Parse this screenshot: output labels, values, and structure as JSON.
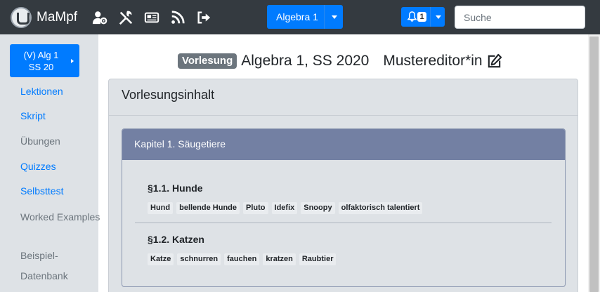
{
  "navbar": {
    "brand": "MaMpf",
    "icons": [
      "user-cog-icon",
      "tools-icon",
      "newspaper-icon",
      "rss-icon",
      "sign-out-icon"
    ],
    "lecture_button": "Algebra 1",
    "notifications": {
      "count": "1",
      "icon": "bell-icon"
    },
    "search": {
      "placeholder": "Suche",
      "value": ""
    },
    "colors": {
      "bar": "#343a40",
      "accent": "#007bff"
    }
  },
  "sidebar": {
    "lecture": {
      "line1": "(V) Alg 1",
      "line2": "SS 20"
    },
    "links": [
      {
        "label": "Lektionen",
        "active": true
      },
      {
        "label": "Skript",
        "active": true
      },
      {
        "label": "Übungen",
        "active": false
      },
      {
        "label": "Quizzes",
        "active": true
      },
      {
        "label": "Selbsttest",
        "active": true
      },
      {
        "label": "Worked Examples",
        "active": false
      }
    ],
    "example_db": {
      "line1": "Beispiel-",
      "line2": "Datenbank"
    }
  },
  "heading": {
    "badge": "Vorlesung",
    "title": "Algebra 1, SS 2020",
    "editor": "Mustereditor*in",
    "edit_icon": "edit-icon"
  },
  "content": {
    "title": "Vorlesungsinhalt",
    "chapter": {
      "title": "Kapitel 1. Säugetiere",
      "sections": [
        {
          "title": "§1.1. Hunde",
          "tags": [
            "Hund",
            "bellende Hunde",
            "Pluto",
            "Idefix",
            "Snoopy",
            "olfaktorisch talentiert"
          ]
        },
        {
          "title": "§1.2. Katzen",
          "tags": [
            "Katze",
            "schnurren",
            "fauchen",
            "kratzen",
            "Raubtier"
          ]
        }
      ]
    }
  }
}
